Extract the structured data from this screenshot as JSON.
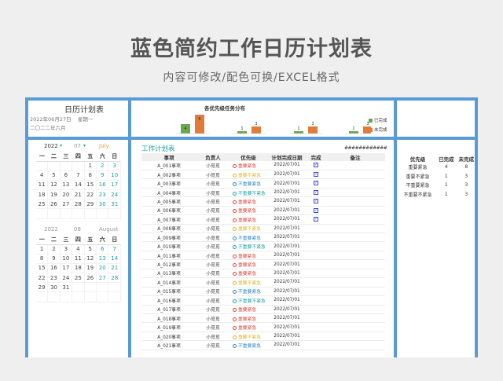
{
  "title": "蓝色简约工作日历计划表",
  "subtitle": "内容可修改/配色可换/EXCEL格式",
  "calendar_panel": {
    "title": "日历计划表",
    "date": "2022年06月27日",
    "weekday": "星期一",
    "chinese_date": "二〇二二年六月"
  },
  "chart_data": {
    "type": "bar",
    "title": "各优先级任务分布",
    "categories": [
      "",
      "",
      "",
      ""
    ],
    "series": [
      {
        "name": "已完成",
        "color": "#6aa84f",
        "values": [
          4,
          1,
          1,
          1
        ]
      },
      {
        "name": "未完成",
        "color": "#e07b39",
        "values": [
          8,
          3,
          3,
          3
        ]
      }
    ],
    "data_labels": [
      "4",
      "8",
      "1",
      "3",
      "1",
      "3",
      "1",
      "3"
    ]
  },
  "calendars": [
    {
      "year": "2022",
      "month": "07",
      "month_name": "July",
      "weekdays": [
        "一",
        "二",
        "三",
        "四",
        "五",
        "六",
        "日"
      ],
      "weeks": [
        [
          "",
          "",
          "",
          "",
          "1",
          "2",
          "3"
        ],
        [
          "4",
          "5",
          "6",
          "7",
          "8",
          "9",
          "10"
        ],
        [
          "11",
          "12",
          "13",
          "14",
          "15",
          "16",
          "17"
        ],
        [
          "18",
          "19",
          "20",
          "21",
          "22",
          "23",
          "24"
        ],
        [
          "25",
          "26",
          "27",
          "28",
          "29",
          "30",
          "31"
        ],
        [
          "",
          "",
          "",
          "",
          "",
          "",
          ""
        ]
      ]
    },
    {
      "year": "2022",
      "month": "08",
      "month_name": "August",
      "weekdays": [
        "一",
        "二",
        "三",
        "四",
        "五",
        "六",
        "日"
      ],
      "weeks": [
        [
          "1",
          "2",
          "3",
          "4",
          "5",
          "6",
          "7"
        ],
        [
          "8",
          "9",
          "10",
          "11",
          "12",
          "13",
          "14"
        ],
        [
          "15",
          "16",
          "17",
          "18",
          "19",
          "20",
          "21"
        ],
        [
          "22",
          "23",
          "24",
          "25",
          "26",
          "27",
          "28"
        ],
        [
          "29",
          "30",
          "31",
          "",
          "",
          "",
          ""
        ],
        [
          "",
          "",
          "",
          "",
          "",
          "",
          ""
        ]
      ]
    }
  ],
  "plan": {
    "title": "工作计划表",
    "hash": "############",
    "columns": [
      "事项",
      "负责人",
      "优先级",
      "计划完成日期",
      "完成",
      "备注"
    ],
    "rows": [
      {
        "item": "A_001事项",
        "owner": "小觅觅",
        "priority": "重要紧急",
        "date": "2022/07/01",
        "done": true
      },
      {
        "item": "A_002事项",
        "owner": "小觅觅",
        "priority": "重要不紧急",
        "date": "2022/07/01",
        "done": true
      },
      {
        "item": "A_003事项",
        "owner": "小觅觅",
        "priority": "不重要紧急",
        "date": "2022/07/01",
        "done": true
      },
      {
        "item": "A_004事项",
        "owner": "小觅觅",
        "priority": "不重要不紧急",
        "date": "2022/07/01",
        "done": true
      },
      {
        "item": "A_005事项",
        "owner": "小觅觅",
        "priority": "重要紧急",
        "date": "2022/07/01",
        "done": true
      },
      {
        "item": "A_006事项",
        "owner": "小觅觅",
        "priority": "重要紧急",
        "date": "2022/07/01",
        "done": true
      },
      {
        "item": "A_007事项",
        "owner": "小觅觅",
        "priority": "重要紧急",
        "date": "2022/07/01",
        "done": true
      },
      {
        "item": "A_008事项",
        "owner": "小觅觅",
        "priority": "重要不紧急",
        "date": "2022/07/01",
        "done": false
      },
      {
        "item": "A_009事项",
        "owner": "小觅觅",
        "priority": "不重要紧急",
        "date": "2022/07/01",
        "done": false
      },
      {
        "item": "A_010事项",
        "owner": "小觅觅",
        "priority": "不重要不紧急",
        "date": "2022/07/01",
        "done": false
      },
      {
        "item": "A_011事项",
        "owner": "小觅觅",
        "priority": "重要紧急",
        "date": "2022/07/01",
        "done": false
      },
      {
        "item": "A_012事项",
        "owner": "小觅觅",
        "priority": "重要紧急",
        "date": "2022/07/01",
        "done": false
      },
      {
        "item": "A_013事项",
        "owner": "小觅觅",
        "priority": "重要紧急",
        "date": "2022/07/01",
        "done": false
      },
      {
        "item": "A_014事项",
        "owner": "小觅觅",
        "priority": "重要不紧急",
        "date": "2022/07/01",
        "done": false
      },
      {
        "item": "A_015事项",
        "owner": "小觅觅",
        "priority": "不重要紧急",
        "date": "2022/07/01",
        "done": false
      },
      {
        "item": "A_016事项",
        "owner": "小觅觅",
        "priority": "不重要不紧急",
        "date": "2022/07/01",
        "done": false
      },
      {
        "item": "A_017事项",
        "owner": "小觅觅",
        "priority": "重要紧急",
        "date": "2022/07/01",
        "done": false
      },
      {
        "item": "A_018事项",
        "owner": "小觅觅",
        "priority": "重要紧急",
        "date": "2022/07/01",
        "done": false
      },
      {
        "item": "A_019事项",
        "owner": "小觅觅",
        "priority": "重要紧急",
        "date": "2022/07/01",
        "done": false
      },
      {
        "item": "A_020事项",
        "owner": "小觅觅",
        "priority": "重要不紧急",
        "date": "2022/07/01",
        "done": false
      },
      {
        "item": "A_021事项",
        "owner": "小觅觅",
        "priority": "不重要紧急",
        "date": "2022/07/01",
        "done": false
      }
    ]
  },
  "priority_colors": {
    "重要紧急": "#e0443a",
    "重要不紧急": "#e6b422",
    "不重要紧急": "#2f86c8",
    "不重要不紧急": "#1ca0a6"
  },
  "stats": {
    "columns": [
      "优先级",
      "已完成",
      "未完成"
    ],
    "rows": [
      [
        "重要紧急",
        "4",
        "8"
      ],
      [
        "重要不紧急",
        "1",
        "3"
      ],
      [
        "不重要紧急",
        "1",
        "3"
      ],
      [
        "不重要不紧急",
        "1",
        "3"
      ]
    ]
  }
}
